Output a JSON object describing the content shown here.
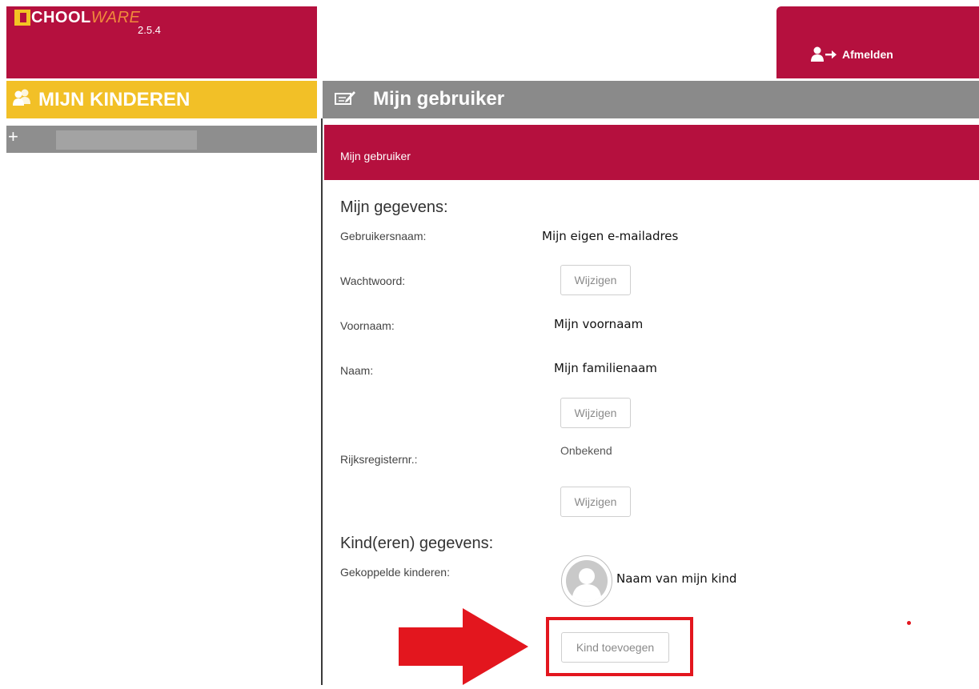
{
  "app": {
    "logo_main": "CHOOL",
    "logo_suffix": "WARE",
    "version": "2.5.4"
  },
  "header": {
    "logout_label": "Afmelden"
  },
  "sidebar": {
    "title": "MIJN KINDEREN",
    "expand_symbol": "+"
  },
  "page": {
    "title": "Mijn gebruiker",
    "breadcrumb": "Mijn gebruiker"
  },
  "my_data": {
    "heading": "Mijn gegevens:",
    "username_label": "Gebruikersnaam:",
    "username_value": "Mijn eigen e-mailadres",
    "password_label": "Wachtwoord:",
    "password_button": "Wijzigen",
    "firstname_label": "Voornaam:",
    "firstname_value": "Mijn voornaam",
    "lastname_label": "Naam:",
    "lastname_value": "Mijn familienaam",
    "name_button": "Wijzigen",
    "national_id_label": "Rijksregisternr.:",
    "national_id_value": "Onbekend",
    "national_id_button": "Wijzigen"
  },
  "children": {
    "heading": "Kind(eren) gegevens:",
    "linked_label": "Gekoppelde kinderen:",
    "child_name": "Naam van mijn kind",
    "add_button": "Kind toevoegen"
  },
  "colors": {
    "brand_red": "#b5103e",
    "sidebar_yellow": "#f2c027",
    "header_gray": "#8a8a8a",
    "annotation_red": "#e3161e"
  }
}
